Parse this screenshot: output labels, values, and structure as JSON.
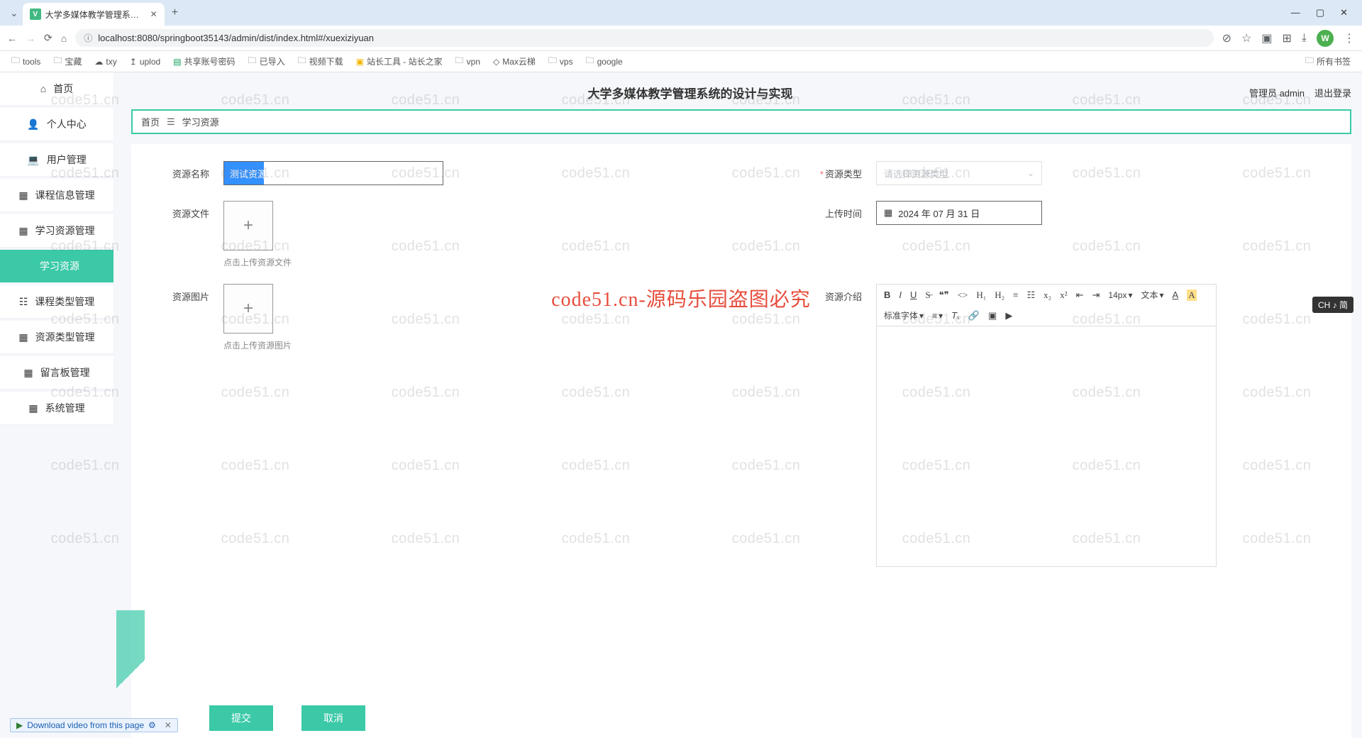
{
  "browser": {
    "tab_title": "大学多媒体教学管理系统的设计",
    "url": "localhost:8080/springboot35143/admin/dist/index.html#/xuexiziyuan",
    "bookmarks": [
      "tools",
      "宝藏",
      "txy",
      "uplod",
      "共享账号密码",
      "已导入",
      "视频下载",
      "站长工具 - 站长之家",
      "vpn",
      "Max云梯",
      "vps",
      "google"
    ],
    "all_bookmarks": "所有书签",
    "avatar_letter": "W"
  },
  "header": {
    "title": "大学多媒体教学管理系统的设计与实现",
    "user_label": "管理员 admin",
    "logout": "退出登录"
  },
  "breadcrumb": {
    "home": "首页",
    "current": "学习资源"
  },
  "sidebar": [
    {
      "label": "首页",
      "icon": "⌂"
    },
    {
      "label": "个人中心",
      "icon": "👤"
    },
    {
      "label": "用户管理",
      "icon": "💻"
    },
    {
      "label": "课程信息管理",
      "icon": "▦"
    },
    {
      "label": "学习资源管理",
      "icon": "▦"
    },
    {
      "label": "学习资源",
      "icon": "",
      "active": true
    },
    {
      "label": "课程类型管理",
      "icon": "☷"
    },
    {
      "label": "资源类型管理",
      "icon": "▦"
    },
    {
      "label": "留言板管理",
      "icon": "▦"
    },
    {
      "label": "系统管理",
      "icon": "▦"
    }
  ],
  "form": {
    "resource_name_label": "资源名称",
    "resource_name_value": "测试资源",
    "resource_type_label": "资源类型",
    "resource_type_placeholder": "请选择资源类型",
    "resource_file_label": "资源文件",
    "resource_file_hint": "点击上传资源文件",
    "upload_time_label": "上传时间",
    "upload_time_value": "2024 年 07 月 31 日",
    "resource_image_label": "资源图片",
    "resource_image_hint": "点击上传资源图片",
    "resource_intro_label": "资源介绍"
  },
  "editor": {
    "font_size": "14px",
    "font_style": "文本",
    "font_family": "标准字体"
  },
  "buttons": {
    "submit": "提交",
    "cancel": "取消"
  },
  "watermark_text": "code51.cn",
  "watermark_center": "code51.cn-源码乐园盗图必究",
  "download_banner": "Download video from this page",
  "ime_badge": "CH ♪ 简"
}
